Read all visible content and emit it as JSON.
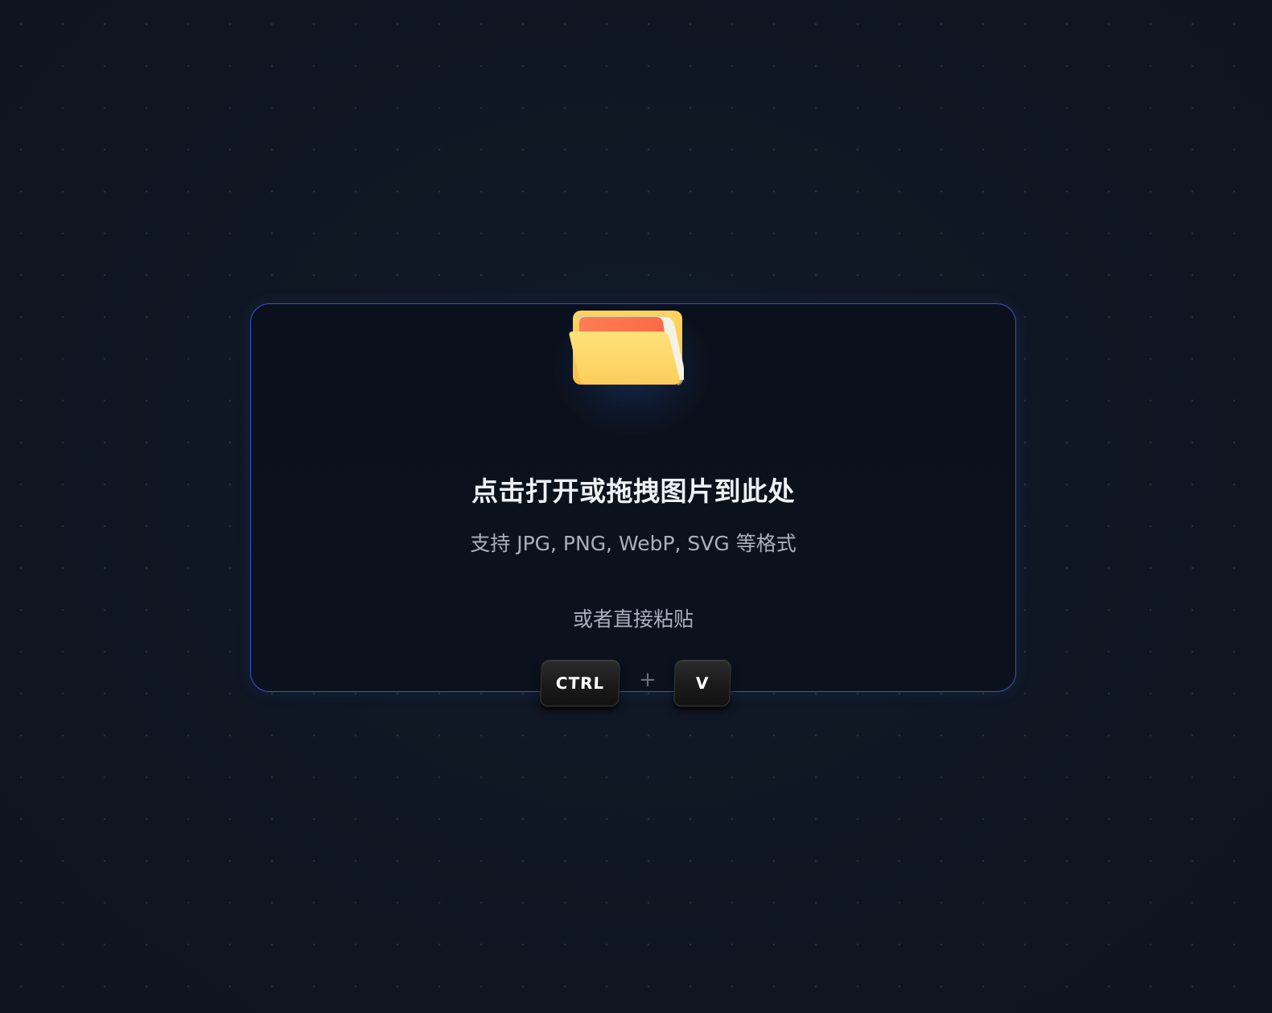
{
  "upload": {
    "title": "点击打开或拖拽图片到此处",
    "subtitle": "支持 JPG, PNG, WebP, SVG 等格式",
    "paste_hint": "或者直接粘贴",
    "icon": "folder-icon"
  },
  "shortcut": {
    "key1": "CTRL",
    "separator": "+",
    "key2": "V"
  },
  "colors": {
    "background": "#111826",
    "border_accent": "#3554c9",
    "folder_yellow": "#fdd96a",
    "folder_orange": "#ff7a4e",
    "title_text": "#eef1f6",
    "muted_text": "#a8b0bd",
    "key_bg": "#1a1a1b"
  }
}
